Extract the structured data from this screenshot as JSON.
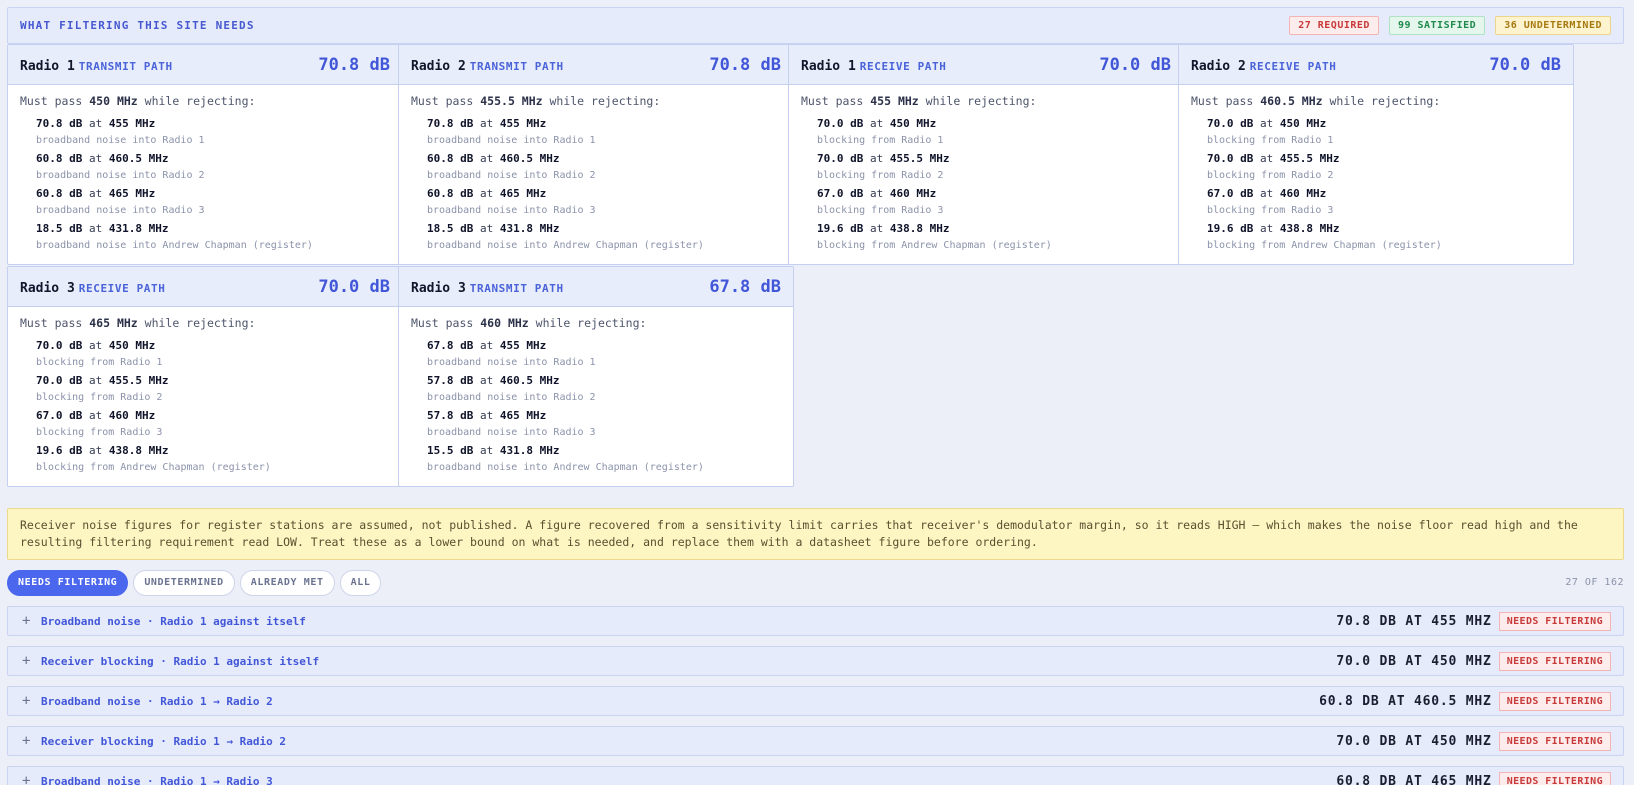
{
  "header": {
    "title": "WHAT FILTERING THIS SITE NEEDS",
    "badges": {
      "required": "27 REQUIRED",
      "satisfied": "99 SATISFIED",
      "undetermined": "36 UNDETERMINED"
    }
  },
  "cards": [
    {
      "radio": "Radio 1",
      "path": "TRANSMIT PATH",
      "value": "70.8 dB",
      "must_prefix": "Must pass ",
      "must_freq": "450 MHz",
      "must_suffix": " while rejecting:",
      "rejections": [
        {
          "db": "70.8 dB",
          "at": " at ",
          "freq": "455 MHz",
          "desc": "broadband noise into Radio 1"
        },
        {
          "db": "60.8 dB",
          "at": " at ",
          "freq": "460.5 MHz",
          "desc": "broadband noise into Radio 2"
        },
        {
          "db": "60.8 dB",
          "at": " at ",
          "freq": "465 MHz",
          "desc": "broadband noise into Radio 3"
        },
        {
          "db": "18.5 dB",
          "at": " at ",
          "freq": "431.8 MHz",
          "desc": "broadband noise into Andrew Chapman (register)"
        }
      ]
    },
    {
      "radio": "Radio 2",
      "path": "TRANSMIT PATH",
      "value": "70.8 dB",
      "must_prefix": "Must pass ",
      "must_freq": "455.5 MHz",
      "must_suffix": " while rejecting:",
      "rejections": [
        {
          "db": "70.8 dB",
          "at": " at ",
          "freq": "455 MHz",
          "desc": "broadband noise into Radio 1"
        },
        {
          "db": "60.8 dB",
          "at": " at ",
          "freq": "460.5 MHz",
          "desc": "broadband noise into Radio 2"
        },
        {
          "db": "60.8 dB",
          "at": " at ",
          "freq": "465 MHz",
          "desc": "broadband noise into Radio 3"
        },
        {
          "db": "18.5 dB",
          "at": " at ",
          "freq": "431.8 MHz",
          "desc": "broadband noise into Andrew Chapman (register)"
        }
      ]
    },
    {
      "radio": "Radio 1",
      "path": "RECEIVE PATH",
      "value": "70.0 dB",
      "must_prefix": "Must pass ",
      "must_freq": "455 MHz",
      "must_suffix": " while rejecting:",
      "rejections": [
        {
          "db": "70.0 dB",
          "at": " at ",
          "freq": "450 MHz",
          "desc": "blocking from Radio 1"
        },
        {
          "db": "70.0 dB",
          "at": " at ",
          "freq": "455.5 MHz",
          "desc": "blocking from Radio 2"
        },
        {
          "db": "67.0 dB",
          "at": " at ",
          "freq": "460 MHz",
          "desc": "blocking from Radio 3"
        },
        {
          "db": "19.6 dB",
          "at": " at ",
          "freq": "438.8 MHz",
          "desc": "blocking from Andrew Chapman (register)"
        }
      ]
    },
    {
      "radio": "Radio 2",
      "path": "RECEIVE PATH",
      "value": "70.0 dB",
      "must_prefix": "Must pass ",
      "must_freq": "460.5 MHz",
      "must_suffix": " while rejecting:",
      "rejections": [
        {
          "db": "70.0 dB",
          "at": " at ",
          "freq": "450 MHz",
          "desc": "blocking from Radio 1"
        },
        {
          "db": "70.0 dB",
          "at": " at ",
          "freq": "455.5 MHz",
          "desc": "blocking from Radio 2"
        },
        {
          "db": "67.0 dB",
          "at": " at ",
          "freq": "460 MHz",
          "desc": "blocking from Radio 3"
        },
        {
          "db": "19.6 dB",
          "at": " at ",
          "freq": "438.8 MHz",
          "desc": "blocking from Andrew Chapman (register)"
        }
      ]
    },
    {
      "radio": "Radio 3",
      "path": "RECEIVE PATH",
      "value": "70.0 dB",
      "must_prefix": "Must pass ",
      "must_freq": "465 MHz",
      "must_suffix": " while rejecting:",
      "rejections": [
        {
          "db": "70.0 dB",
          "at": " at ",
          "freq": "450 MHz",
          "desc": "blocking from Radio 1"
        },
        {
          "db": "70.0 dB",
          "at": " at ",
          "freq": "455.5 MHz",
          "desc": "blocking from Radio 2"
        },
        {
          "db": "67.0 dB",
          "at": " at ",
          "freq": "460 MHz",
          "desc": "blocking from Radio 3"
        },
        {
          "db": "19.6 dB",
          "at": " at ",
          "freq": "438.8 MHz",
          "desc": "blocking from Andrew Chapman (register)"
        }
      ]
    },
    {
      "radio": "Radio 3",
      "path": "TRANSMIT PATH",
      "value": "67.8 dB",
      "must_prefix": "Must pass ",
      "must_freq": "460 MHz",
      "must_suffix": " while rejecting:",
      "rejections": [
        {
          "db": "67.8 dB",
          "at": " at ",
          "freq": "455 MHz",
          "desc": "broadband noise into Radio 1"
        },
        {
          "db": "57.8 dB",
          "at": " at ",
          "freq": "460.5 MHz",
          "desc": "broadband noise into Radio 2"
        },
        {
          "db": "57.8 dB",
          "at": " at ",
          "freq": "465 MHz",
          "desc": "broadband noise into Radio 3"
        },
        {
          "db": "15.5 dB",
          "at": " at ",
          "freq": "431.8 MHz",
          "desc": "broadband noise into Andrew Chapman (register)"
        }
      ]
    }
  ],
  "note": "Receiver noise figures for register stations are assumed, not published. A figure recovered from a sensitivity limit carries that receiver's demodulator margin, so it reads HIGH — which makes the noise floor read high and the resulting filtering requirement read LOW. Treat these as a lower bound on what is needed, and replace them with a datasheet figure before ordering.",
  "filters": {
    "items": [
      "NEEDS FILTERING",
      "UNDETERMINED",
      "ALREADY MET",
      "ALL"
    ],
    "active": "NEEDS FILTERING",
    "count": "27 OF 162"
  },
  "rows": [
    {
      "icon": "plus-icon",
      "expander": "+",
      "title": "Broadband noise · Radio 1 against itself",
      "value": "70.8 DB AT 455 MHZ",
      "status": "NEEDS FILTERING"
    },
    {
      "icon": "plus-icon",
      "expander": "+",
      "title": "Receiver blocking · Radio 1 against itself",
      "value": "70.0 DB AT 450 MHZ",
      "status": "NEEDS FILTERING"
    },
    {
      "icon": "plus-icon",
      "expander": "+",
      "title": "Broadband noise · Radio 1 → Radio 2",
      "value": "60.8 DB AT 460.5 MHZ",
      "status": "NEEDS FILTERING"
    },
    {
      "icon": "plus-icon",
      "expander": "+",
      "title": "Receiver blocking · Radio 1 → Radio 2",
      "value": "70.0 DB AT 450 MHZ",
      "status": "NEEDS FILTERING"
    },
    {
      "icon": "plus-icon",
      "expander": "+",
      "title": "Broadband noise · Radio 1 → Radio 3",
      "value": "60.8 DB AT 465 MHZ",
      "status": "NEEDS FILTERING"
    }
  ],
  "colors": {
    "accent": "#4a67ee",
    "required": "#c83a3a",
    "satisfied": "#1f8a4c",
    "undetermined": "#a77a10",
    "note_background": "#fdf6c2"
  }
}
